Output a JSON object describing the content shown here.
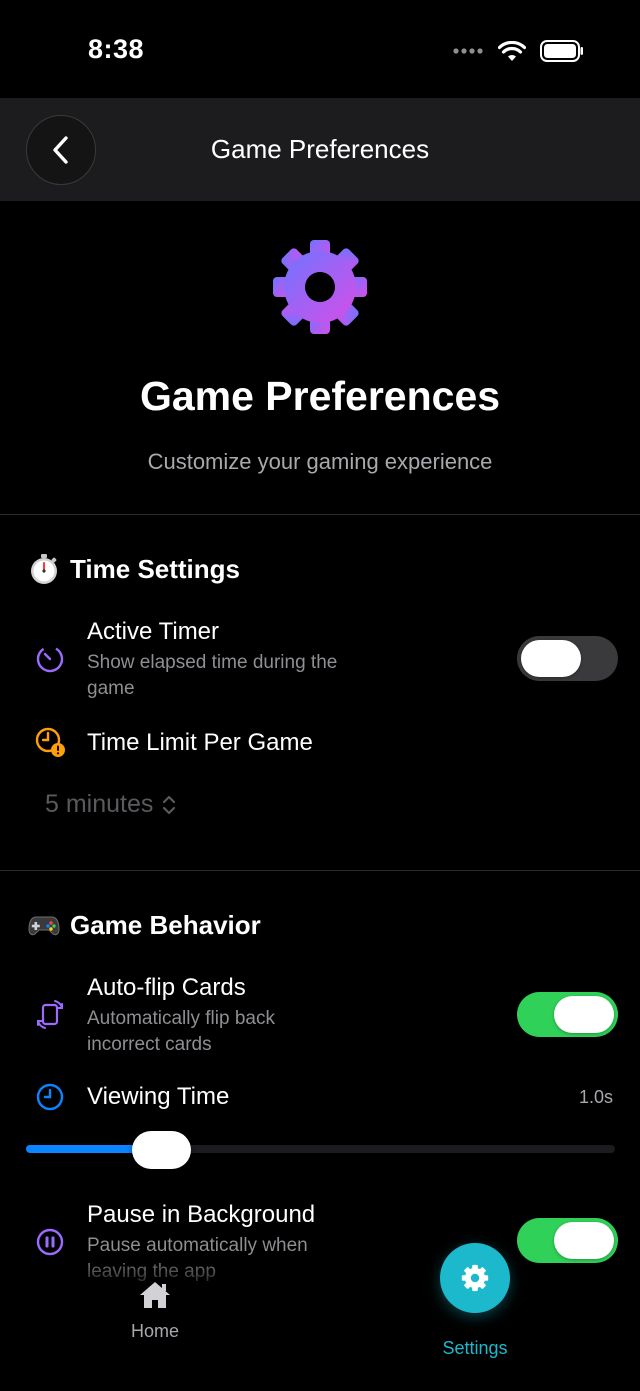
{
  "status_bar": {
    "time": "8:38"
  },
  "nav": {
    "title": "Game Preferences"
  },
  "hero": {
    "title": "Game Preferences",
    "subtitle": "Customize your gaming experience"
  },
  "sections": {
    "time": {
      "title": "Time Settings",
      "active_timer": {
        "title": "Active Timer",
        "description": "Show elapsed time during the game",
        "enabled": false
      },
      "time_limit": {
        "title": "Time Limit Per Game",
        "value": "5 minutes"
      }
    },
    "behavior": {
      "title": "Game Behavior",
      "auto_flip": {
        "title": "Auto-flip Cards",
        "description": "Automatically flip back incorrect cards",
        "enabled": true
      },
      "viewing_time": {
        "title": "Viewing Time",
        "value_label": "1.0s",
        "slider_fraction": 0.23
      },
      "pause_background": {
        "title": "Pause in Background",
        "description": "Pause automatically when leaving the app",
        "enabled": true
      }
    }
  },
  "tabs": {
    "home": {
      "label": "Home"
    },
    "settings": {
      "label": "Settings"
    }
  },
  "colors": {
    "accent": "#1cb9cc",
    "toggle_on": "#30d158",
    "slider": "#0a84ff",
    "gear_gradient_start": "#7b6bff",
    "gear_gradient_end": "#d64ee8"
  },
  "icons": {
    "back": "chevron-left-icon",
    "hero": "gear-icon",
    "time_section": "stopwatch-icon",
    "active_timer": "timer-icon",
    "time_limit": "clock-alert-icon",
    "picker": "chevron-up-down-icon",
    "behavior_section": "gamepad-icon",
    "auto_flip": "rotate-device-icon",
    "viewing_time": "clock-icon",
    "pause": "pause-circle-icon",
    "home": "house-icon",
    "settings": "gear-icon"
  }
}
